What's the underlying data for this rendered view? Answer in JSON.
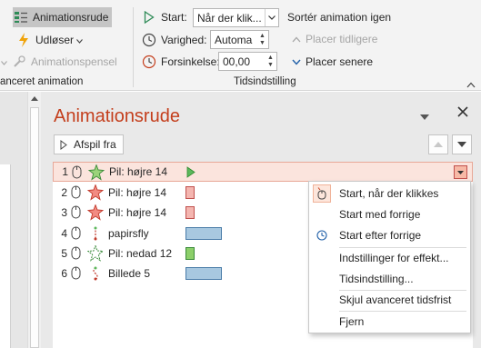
{
  "ribbon": {
    "animation_pane_label": "Animationsrude",
    "trigger_label": "Udløser",
    "painter_label": "Animationspensel",
    "advanced_group_label": "anceret animation",
    "start_label": "Start:",
    "start_value": "Når der klik...",
    "duration_label": "Varighed:",
    "duration_value": "Automa",
    "delay_label": "Forsinkelse:",
    "delay_value": "00,00",
    "timing_group_label": "Tidsindstilling",
    "reorder_title": "Sortér animation igen",
    "move_earlier_label": "Placer tidligere",
    "move_later_label": "Placer senere"
  },
  "pane": {
    "title": "Animationsrude",
    "play_button_label": "Afspil fra",
    "items": [
      {
        "num": "1",
        "name": "Pil: højre 14",
        "effect": "entrance-star-green",
        "timeline": "play-marker"
      },
      {
        "num": "2",
        "name": "Pil: højre 14",
        "effect": "exit-star-red",
        "timeline": "small-red-bar"
      },
      {
        "num": "3",
        "name": "Pil: højre 14",
        "effect": "exit-star-red",
        "timeline": "small-red-bar"
      },
      {
        "num": "4",
        "name": "papirsfly",
        "effect": "motion-path",
        "timeline": "long-blue-bar"
      },
      {
        "num": "5",
        "name": "Pil: nedad 12",
        "effect": "entrance-star-green-outline",
        "timeline": "small-green-bar"
      },
      {
        "num": "6",
        "name": "Billede 5",
        "effect": "motion-path",
        "timeline": "long-blue-bar"
      }
    ]
  },
  "context_menu": {
    "items": [
      {
        "label": "Start, når der klikkes",
        "icon": "mouse-click-icon",
        "checked": true
      },
      {
        "label": "Start med forrige",
        "icon": ""
      },
      {
        "label": "Start efter forrige",
        "icon": "clock-icon"
      },
      {
        "label": "Indstillinger for effekt...",
        "icon": ""
      },
      {
        "label": "Tidsindstilling...",
        "icon": ""
      },
      {
        "label": "Skjul avanceret tidsfrist",
        "icon": ""
      },
      {
        "label": "Fjern",
        "icon": ""
      }
    ]
  },
  "colors": {
    "accent": "#c43e1c",
    "selected_row_bg": "#fbe4dd",
    "ribbon_bg": "#f3f3f3",
    "pane_bg": "#e9e9e9",
    "bar_blue": "#a8c8e0",
    "bar_red": "#f4b6b0",
    "bar_green": "#8ccf6a"
  }
}
